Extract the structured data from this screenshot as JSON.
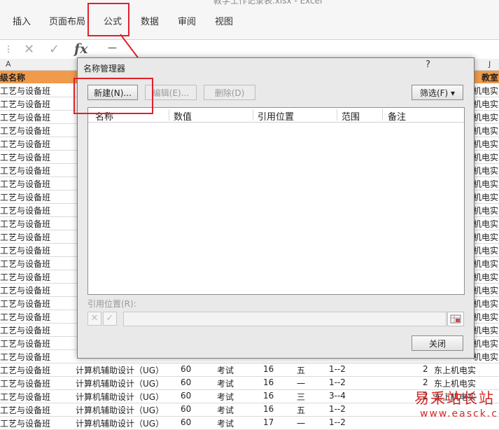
{
  "window_title_fragment": "教学工作记录表.xlsx - Excel",
  "ribbon": {
    "tabs": [
      "插入",
      "页面布局",
      "公式",
      "数据",
      "审阅",
      "视图"
    ]
  },
  "formula_bar": {
    "value": "—"
  },
  "sheet": {
    "col_a": "A",
    "col_j": "J",
    "header_left": "级名称",
    "header_right": "教室",
    "left_rows_text": "工艺与设备班",
    "right_rows_text": "机电实",
    "bottom_rows": [
      {
        "a": "工艺与设备班",
        "b": "计算机辅助设计（UG）",
        "c": "60",
        "d": "考试",
        "e": "16",
        "f": "五",
        "g": "1--2",
        "h": "2",
        "i": "东上机电实"
      },
      {
        "a": "工艺与设备班",
        "b": "计算机辅助设计（UG）",
        "c": "60",
        "d": "考试",
        "e": "16",
        "f": "一",
        "g": "1--2",
        "h": "2",
        "i": "东上机电实"
      },
      {
        "a": "工艺与设备班",
        "b": "计算机辅助设计（UG）",
        "c": "60",
        "d": "考试",
        "e": "16",
        "f": "三",
        "g": "3--4",
        "h": "2",
        "i": "东上机电实"
      },
      {
        "a": "工艺与设备班",
        "b": "计算机辅助设计（UG）",
        "c": "60",
        "d": "考试",
        "e": "16",
        "f": "五",
        "g": "1--2",
        "h": "",
        "i": ""
      },
      {
        "a": "工艺与设备班",
        "b": "计算机辅助设计（UG）",
        "c": "60",
        "d": "考试",
        "e": "17",
        "f": "一",
        "g": "1--2",
        "h": "",
        "i": ""
      }
    ]
  },
  "dialog": {
    "title": "名称管理器",
    "help": "?",
    "buttons": {
      "new": "新建(N)...",
      "edit": "编辑(E)...",
      "delete": "删除(D)",
      "filter": "筛选(F) ▾",
      "close": "关闭"
    },
    "columns": [
      "名称",
      "数值",
      "引用位置",
      "范围",
      "备注"
    ],
    "ref_label": "引用位置(R):"
  },
  "watermark": {
    "line1": "易采站长站",
    "line2": "www.easck.com"
  },
  "colors": {
    "annotation": "#e0202a",
    "header_fill": "#f09a4a"
  }
}
